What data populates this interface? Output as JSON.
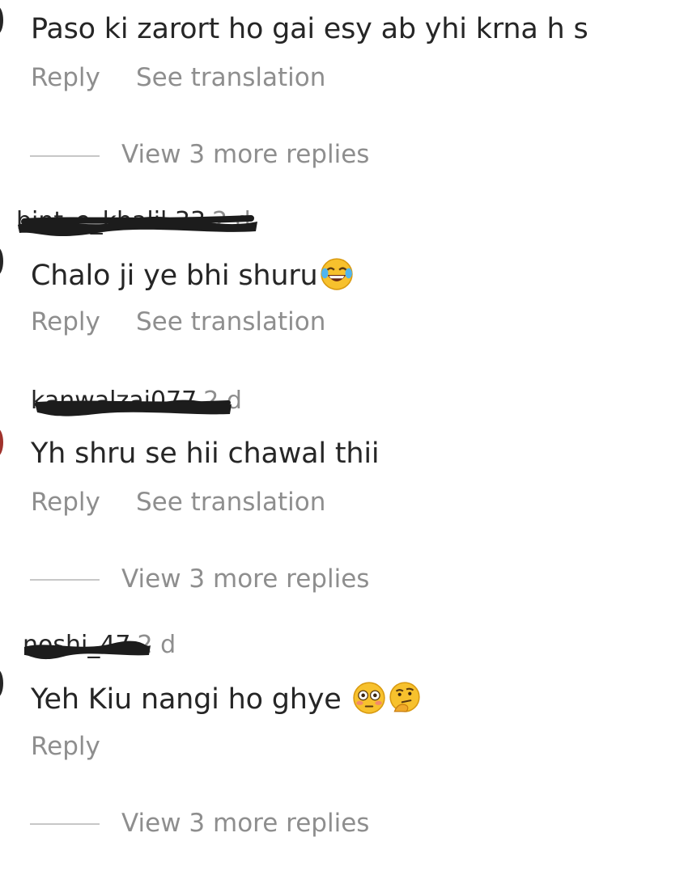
{
  "colors": {
    "text": "#262626",
    "muted": "#8e8e8e",
    "divider": "#c7c7c7",
    "scribble": "#1c1c1c"
  },
  "comments": [
    {
      "text": "Paso ki zarort ho gai esy ab yhi krna h s",
      "reply": "Reply",
      "translate": "See translation"
    },
    {
      "username": "bint_e_khalil.33",
      "time": "2 d",
      "text": "Chalo ji ye bhi shuru",
      "emojis": [
        "face-with-tears-of-joy-icon"
      ],
      "reply": "Reply",
      "translate": "See translation"
    },
    {
      "username": "kanwalzai077",
      "time": "2 d",
      "text": "Yh shru se hii chawal thii",
      "reply": "Reply",
      "translate": "See translation"
    },
    {
      "username": "noshi_47",
      "time": "2 d",
      "text": "Yeh Kiu nangi ho ghye",
      "emojis": [
        "flushed-face-icon",
        "thinking-face-icon"
      ],
      "reply": "Reply"
    }
  ],
  "more_replies": [
    "View 3 more replies",
    "View 3 more replies",
    "View 3 more replies"
  ]
}
